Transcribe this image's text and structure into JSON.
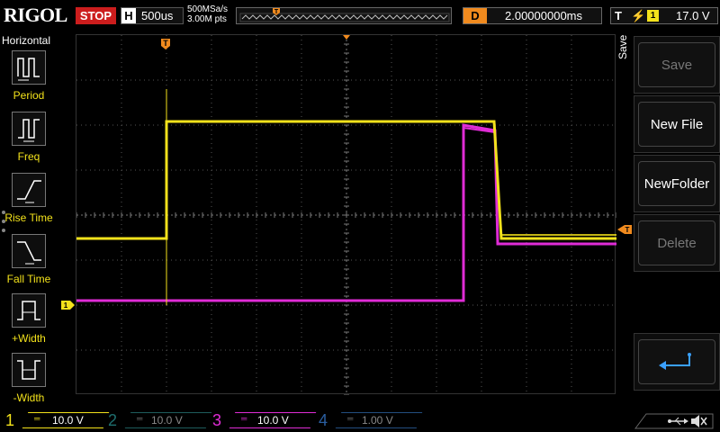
{
  "header": {
    "logo": "RIGOL",
    "run_state": "STOP",
    "timebase_label": "H",
    "timebase_value": "500us",
    "sample_rate": "500MSa/s",
    "memory_depth": "3.00M pts",
    "trigger_pos_marker": "T",
    "delay_label": "D",
    "delay_value": "2.00000000ms",
    "trigger_label": "T",
    "trigger_edge": "rising-edge",
    "trigger_source": "1",
    "trigger_level": "17.0 V"
  },
  "left_panel": {
    "title": "Horizontal",
    "items": [
      {
        "label": "Period",
        "icon": "period-icon"
      },
      {
        "label": "Freq",
        "icon": "freq-icon"
      },
      {
        "label": "Rise Time",
        "icon": "rise-time-icon"
      },
      {
        "label": "Fall Time",
        "icon": "fall-time-icon"
      },
      {
        "label": "+Width",
        "icon": "positive-width-icon"
      },
      {
        "label": "-Width",
        "icon": "negative-width-icon"
      }
    ]
  },
  "right_panel": {
    "menu_title": "Save",
    "softkeys": [
      {
        "label": "Save",
        "enabled": false
      },
      {
        "label": "New File",
        "enabled": true
      },
      {
        "label": "NewFolder",
        "enabled": true
      },
      {
        "label": "Delete",
        "enabled": false
      },
      {
        "label": "",
        "icon": "return-icon",
        "enabled": true
      }
    ]
  },
  "screen": {
    "trigger_marker_top": "T",
    "trigger_level_marker": "T",
    "ch1_ground_marker": "1",
    "colors": {
      "ch1": "#f3e21b",
      "ch2": "#16a7a7",
      "ch3": "#e02cd6",
      "ch4": "#3a7fd6",
      "grid": "#555555",
      "marker": "#f08a1e"
    }
  },
  "channels": [
    {
      "number": "1",
      "scale": "10.0 V",
      "active": true
    },
    {
      "number": "2",
      "scale": "10.0 V",
      "active": false
    },
    {
      "number": "3",
      "scale": "10.0 V",
      "active": true
    },
    {
      "number": "4",
      "scale": "1.00 V",
      "active": false
    }
  ],
  "status": {
    "usb_icon": "usb-icon",
    "sound_icon": "speaker-muted-icon"
  }
}
